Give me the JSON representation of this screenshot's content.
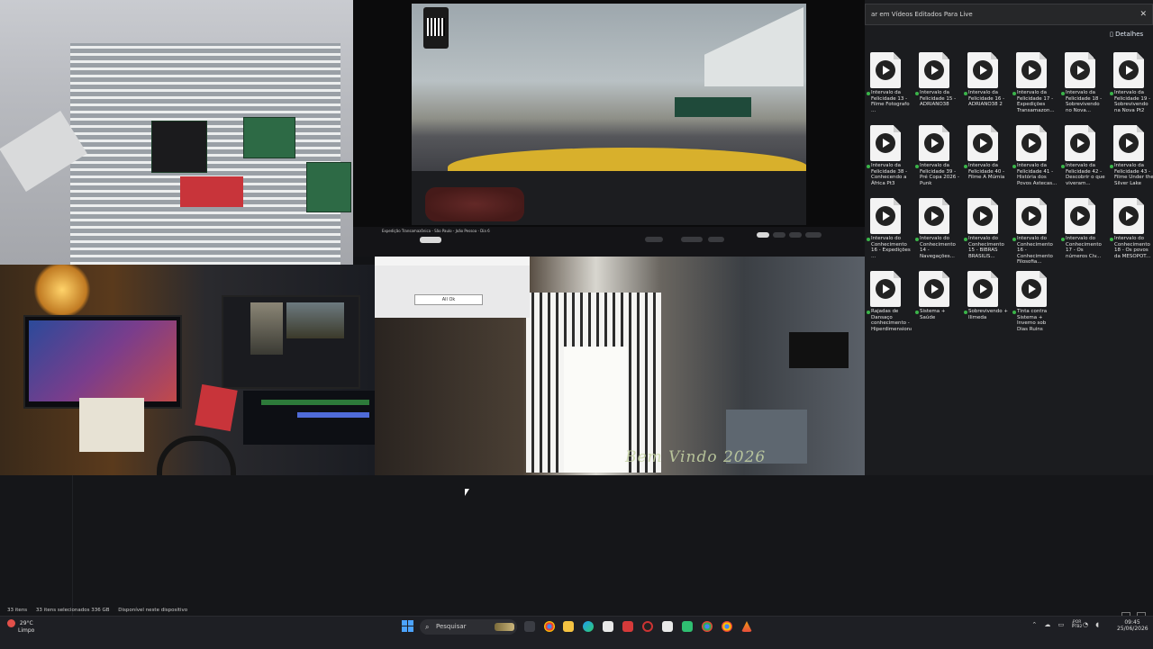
{
  "video": {
    "caption": "Expedição Transamazônica - São Paulo - João Pessoa - Dia 6"
  },
  "dialog": {
    "button_label": "All Ok"
  },
  "overlay": {
    "welcome_text": "Bem Vindo 2026"
  },
  "explorer": {
    "address": "ar em Vídeos Editados Para Live",
    "toolbar_label": "Detalhes",
    "files": [
      {
        "name": "Intervalo da Felicidade 13 - Filme Fotografo ..."
      },
      {
        "name": "Intervalo da Felicidade 15 - ADRIANO38"
      },
      {
        "name": "Intervalo da Felicidade 16 - ADRIANO38 2"
      },
      {
        "name": "Intervalo da Felicidade 17 - Expedições Transamazon..."
      },
      {
        "name": "Intervalo da Felicidade 18 - Sobrevivendo no Nova..."
      },
      {
        "name": "Intervalo da Felicidade 19 - Sobrevivendo na Nova Pt2"
      },
      {
        "name": "Intervalo da Felicidade 38 - Conhecendo a África Pt3"
      },
      {
        "name": "Intervalo da Felicidade 39 - Pré Copa 2026 - Punk"
      },
      {
        "name": "Intervalo da Felicidade 40 - Filme A Múmia"
      },
      {
        "name": "Intervalo da Felicidade 41 - História dos Povos Astecas..."
      },
      {
        "name": "Intervalo da Felicidade 42 - Descobrir o que viveram..."
      },
      {
        "name": "Intervalo da Felicidade 43 - Filme Under the Silver Lake"
      },
      {
        "name": "Intervalo do Conhecimento 16 - Expedições ..."
      },
      {
        "name": "Intervalo do Conhecimento 14 - Navegações..."
      },
      {
        "name": "Intervalo do Conhecimento 15 - BIBRAS BRASILIS..."
      },
      {
        "name": "Intervalo do Conhecimento 16 - Conhecimento Filosofia..."
      },
      {
        "name": "Intervalo do Conhecimento 17 - Os números Civ..."
      },
      {
        "name": "Intervalo do Conhecimento 18 - Os povos da MESOPOT..."
      },
      {
        "name": "Rajadas de Dansaço conhecimento - Hiperdimensional"
      },
      {
        "name": "Sistema + Saúde"
      },
      {
        "name": "Sobrevivendo + Ilimeda"
      },
      {
        "name": "Tinta contra Sistema + Inverno sob Dias Ruins"
      }
    ]
  },
  "status_bar": {
    "items_count": "33 itens",
    "selection": "33 itens selecionados  336 GB",
    "availability": "Disponível neste dispositivo"
  },
  "taskbar": {
    "weather_temp": "29°C",
    "weather_desc": "Limpo",
    "search_placeholder": "Pesquisar",
    "language_top": "POR",
    "language_bottom": "PTB2",
    "time": "09:45",
    "date": "25/06/2026"
  },
  "colors": {
    "taskbar_bg": "#1e1f24",
    "explorer_bg": "#1b1c1f",
    "accent_blue": "#4ca3ff",
    "sync_green": "#3bb54a"
  }
}
